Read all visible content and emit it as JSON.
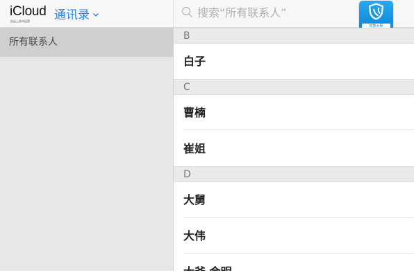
{
  "header": {
    "brand": "iCloud",
    "brand_sub": "由云上贵州运营",
    "app_name": "通讯录",
    "search_placeholder": "搜索“所有联系人”",
    "badge_text": "恢复大师"
  },
  "sidebar": {
    "items": [
      {
        "label": "所有联系人",
        "selected": true
      }
    ]
  },
  "contacts": {
    "sections": [
      {
        "letter": "B",
        "names": [
          "白子"
        ]
      },
      {
        "letter": "C",
        "names": [
          "曹楠",
          "崔姐"
        ]
      },
      {
        "letter": "D",
        "names": [
          "大舅",
          "大伟",
          "大爷 金明"
        ]
      }
    ]
  },
  "colors": {
    "accent": "#2b86e8",
    "sidebar_bg": "#e7e7e7",
    "sidebar_selected": "#cfcfcf",
    "section_bg": "#eaeaea"
  }
}
